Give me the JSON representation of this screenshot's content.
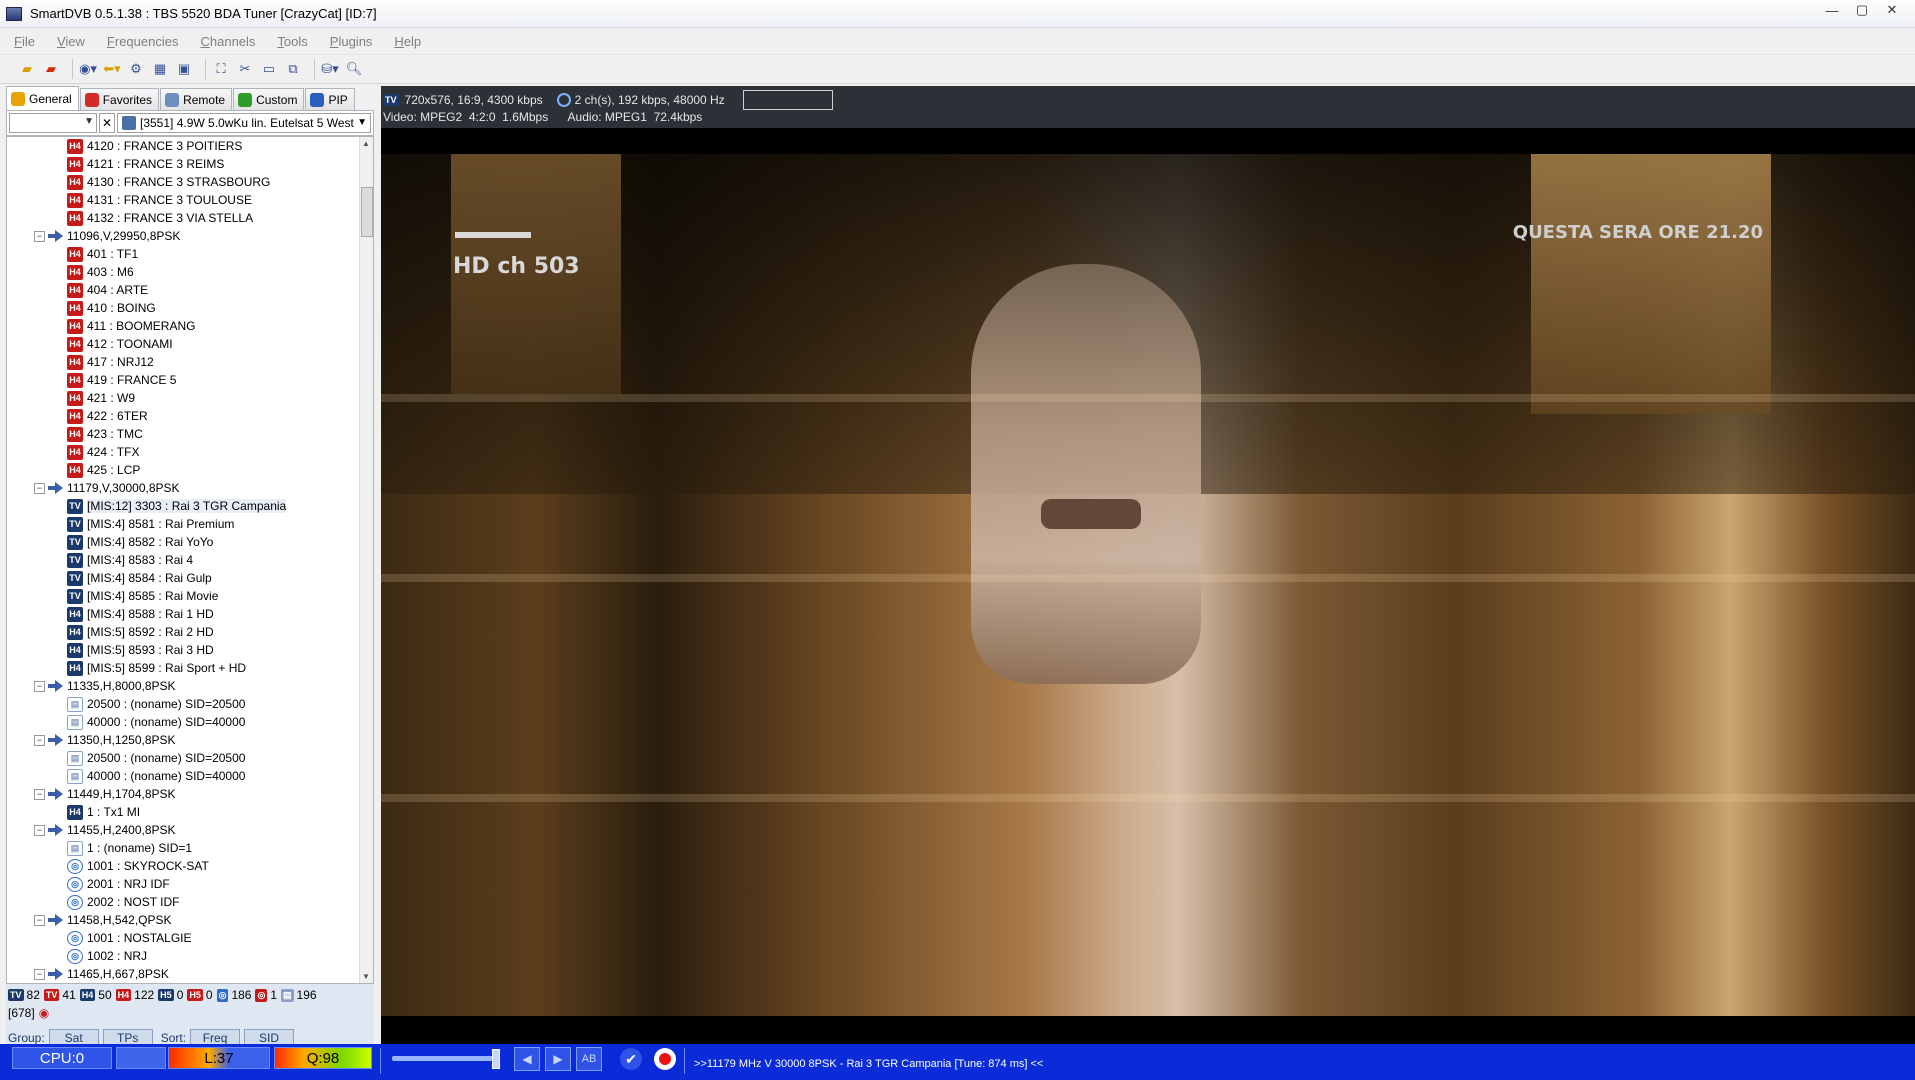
{
  "window": {
    "title": "SmartDVB 0.5.1.38 : TBS 5520 BDA Tuner [CrazyCat] [ID:7]",
    "controls": [
      "—",
      "▢",
      "✕"
    ]
  },
  "menu": [
    "File",
    "View",
    "Frequencies",
    "Channels",
    "Tools",
    "Plugins",
    "Help"
  ],
  "tabs": [
    {
      "label": "General",
      "color": "#e8a400"
    },
    {
      "label": "Favorites",
      "color": "#d42a2a"
    },
    {
      "label": "Remote",
      "color": "#6a8fbf"
    },
    {
      "label": "Custom",
      "color": "#2a9d2a"
    },
    {
      "label": "PIP",
      "color": "#2a5fbf"
    }
  ],
  "satellite_selector": "[3551]  4.9W  5.0wKu lin. Eutelsat 5 West",
  "tree": [
    {
      "kind": "ch",
      "icon": "H4",
      "label": "4120 : FRANCE 3 POITIERS"
    },
    {
      "kind": "ch",
      "icon": "H4",
      "label": "4121 : FRANCE 3 REIMS"
    },
    {
      "kind": "ch",
      "icon": "H4",
      "label": "4130 : FRANCE 3 STRASBOURG"
    },
    {
      "kind": "ch",
      "icon": "H4",
      "label": "4131 : FRANCE 3 TOULOUSE"
    },
    {
      "kind": "ch",
      "icon": "H4",
      "label": "4132 : FRANCE 3 VIA STELLA"
    },
    {
      "kind": "tp",
      "label": "11096,V,29950,8PSK"
    },
    {
      "kind": "ch",
      "icon": "H4",
      "label": "401 : TF1"
    },
    {
      "kind": "ch",
      "icon": "H4",
      "label": "403 : M6"
    },
    {
      "kind": "ch",
      "icon": "H4",
      "label": "404 : ARTE"
    },
    {
      "kind": "ch",
      "icon": "H4",
      "label": "410 : BOING"
    },
    {
      "kind": "ch",
      "icon": "H4",
      "label": "411 : BOOMERANG"
    },
    {
      "kind": "ch",
      "icon": "H4",
      "label": "412 : TOONAMI"
    },
    {
      "kind": "ch",
      "icon": "H4",
      "label": "417 : NRJ12"
    },
    {
      "kind": "ch",
      "icon": "H4",
      "label": "419 : FRANCE 5"
    },
    {
      "kind": "ch",
      "icon": "H4",
      "label": "421 : W9"
    },
    {
      "kind": "ch",
      "icon": "H4",
      "label": "422 : 6TER"
    },
    {
      "kind": "ch",
      "icon": "H4",
      "label": "423 : TMC"
    },
    {
      "kind": "ch",
      "icon": "H4",
      "label": "424 : TFX"
    },
    {
      "kind": "ch",
      "icon": "H4",
      "label": "425 : LCP"
    },
    {
      "kind": "tp",
      "label": "11179,V,30000,8PSK"
    },
    {
      "kind": "ch",
      "icon": "TV",
      "label": "[MIS:12] 3303 : Rai 3 TGR Campania",
      "selected": true
    },
    {
      "kind": "ch",
      "icon": "TV",
      "label": "[MIS:4] 8581 : Rai Premium"
    },
    {
      "kind": "ch",
      "icon": "TV",
      "label": "[MIS:4] 8582 : Rai YoYo"
    },
    {
      "kind": "ch",
      "icon": "TV",
      "label": "[MIS:4] 8583 : Rai 4"
    },
    {
      "kind": "ch",
      "icon": "TV",
      "label": "[MIS:4] 8584 : Rai Gulp"
    },
    {
      "kind": "ch",
      "icon": "TV",
      "label": "[MIS:4] 8585 : Rai Movie"
    },
    {
      "kind": "ch",
      "icon": "H4b",
      "label": "[MIS:4] 8588 : Rai 1 HD"
    },
    {
      "kind": "ch",
      "icon": "H4b",
      "label": "[MIS:5] 8592 : Rai 2 HD"
    },
    {
      "kind": "ch",
      "icon": "H4b",
      "label": "[MIS:5] 8593 : Rai 3 HD"
    },
    {
      "kind": "ch",
      "icon": "H4b",
      "label": "[MIS:5] 8599 : Rai Sport + HD"
    },
    {
      "kind": "tp",
      "label": "11335,H,8000,8PSK"
    },
    {
      "kind": "ch",
      "icon": "data",
      "label": "20500 : (noname) SID=20500"
    },
    {
      "kind": "ch",
      "icon": "data",
      "label": "40000 : (noname) SID=40000"
    },
    {
      "kind": "tp",
      "label": "11350,H,1250,8PSK"
    },
    {
      "kind": "ch",
      "icon": "data",
      "label": "20500 : (noname) SID=20500"
    },
    {
      "kind": "ch",
      "icon": "data",
      "label": "40000 : (noname) SID=40000"
    },
    {
      "kind": "tp",
      "label": "11449,H,1704,8PSK"
    },
    {
      "kind": "ch",
      "icon": "H4b",
      "label": "1 : Tx1 MI"
    },
    {
      "kind": "tp",
      "label": "11455,H,2400,8PSK"
    },
    {
      "kind": "ch",
      "icon": "data",
      "label": "1 : (noname) SID=1"
    },
    {
      "kind": "ch",
      "icon": "radio",
      "label": "1001 : SKYROCK-SAT"
    },
    {
      "kind": "ch",
      "icon": "radio",
      "label": "2001 : NRJ IDF"
    },
    {
      "kind": "ch",
      "icon": "radio",
      "label": "2002 : NOST IDF"
    },
    {
      "kind": "tp",
      "label": "11458,H,542,QPSK"
    },
    {
      "kind": "ch",
      "icon": "radio",
      "label": "1001 : NOSTALGIE"
    },
    {
      "kind": "ch",
      "icon": "radio",
      "label": "1002 : NRJ"
    },
    {
      "kind": "tp",
      "label": "11465,H,667,8PSK"
    }
  ],
  "stats": {
    "line1": [
      {
        "badge": "TV",
        "color": "#1b3a6b",
        "value": "82"
      },
      {
        "badge": "TV",
        "color": "#c41a1a",
        "value": "41"
      },
      {
        "badge": "H4",
        "color": "#1b3a6b",
        "value": "50"
      },
      {
        "badge": "H4",
        "color": "#c41a1a",
        "value": "122"
      },
      {
        "badge": "H5",
        "color": "#1b3a6b",
        "value": "0"
      },
      {
        "badge": "H5",
        "color": "#c41a1a",
        "value": "0"
      },
      {
        "badge": "◎",
        "color": "#2e6bc9",
        "value": "186"
      },
      {
        "badge": "◎",
        "color": "#c41a1a",
        "value": "1"
      },
      {
        "badge": "▤",
        "color": "#8aa0c4",
        "value": "196"
      }
    ],
    "total": "[678]"
  },
  "group": {
    "group_label": "Group:",
    "sat": "Sat",
    "tps": "TPs",
    "sort_label": "Sort:",
    "freq": "Freq",
    "sid": "SID"
  },
  "video_info": {
    "badge": "TV",
    "line1_video": "720x576, 16:9, 4300 kbps",
    "line1_audio": "2 ch(s), 192 kbps, 48000 Hz",
    "line2": "Video: MPEG2  4:2:0  1.6Mbps      Audio: MPEG1  72.4kbps"
  },
  "osd": {
    "left": "HD ch 503",
    "right": "QUESTA SERA ORE 21.20"
  },
  "status": {
    "cpu": "CPU:0",
    "level": "L:37",
    "quality": "Q:98",
    "ab": "AB",
    "text": ">>11179 MHz V 30000 8PSK - Rai 3 TGR Campania [Tune: 874 ms] <<"
  }
}
